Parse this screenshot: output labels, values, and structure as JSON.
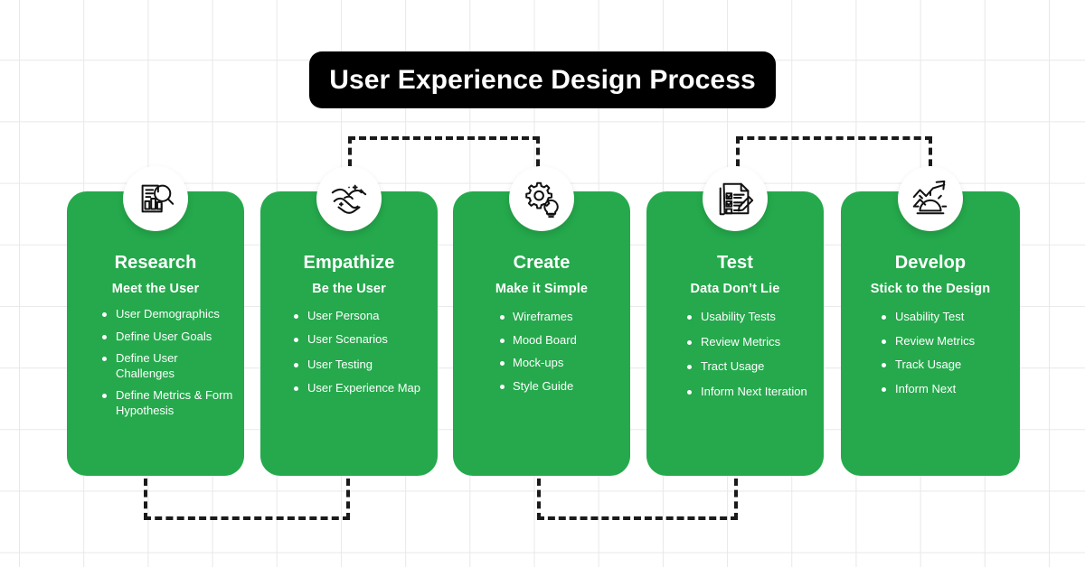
{
  "header": {
    "title": "User Experience Design Process",
    "background_color": "#000000",
    "text_color": "#ffffff"
  },
  "theme": {
    "card_color": "#25a94c",
    "card_text_color": "#ffffff",
    "connector_color": "#1a1a1a",
    "grid_color": "#e8e8e8",
    "page_background": "#ffffff"
  },
  "steps": [
    {
      "title": "Research",
      "subtitle": "Meet the User",
      "icon": "chart-document-magnifier-icon",
      "items": [
        "User Demographics",
        "Define User Goals",
        "Define User Challenges",
        "Define Metrics & Form Hypothesis"
      ]
    },
    {
      "title": "Empathize",
      "subtitle": "Be the User",
      "icon": "caring-hands-sparkle-icon",
      "items": [
        "User Persona",
        "User Scenarios",
        "User Testing",
        "User Experience Map"
      ]
    },
    {
      "title": "Create",
      "subtitle": "Make it Simple",
      "icon": "gear-lightbulb-icon",
      "items": [
        "Wireframes",
        "Mood Board",
        "Mock-ups",
        "Style Guide"
      ]
    },
    {
      "title": "Test",
      "subtitle": "Data Don’t Lie",
      "icon": "checklist-pen-icon",
      "items": [
        "Usability Tests",
        "Review Metrics",
        "Tract Usage",
        "Inform Next Iteration"
      ]
    },
    {
      "title": "Develop",
      "subtitle": "Stick to the Design",
      "icon": "growth-arrow-gear-icon",
      "items": [
        "Usability Test",
        "Review Metrics",
        "Track Usage",
        "Inform Next"
      ]
    }
  ]
}
